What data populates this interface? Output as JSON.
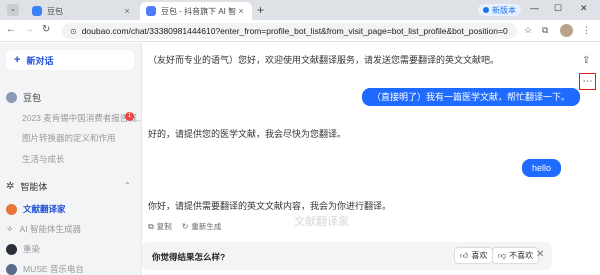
{
  "browser": {
    "tabs": [
      {
        "label": "豆包",
        "close": "×"
      },
      {
        "label": "豆包 - 抖音旗下 AI 智能助手",
        "close": "×"
      }
    ],
    "new_tab": "+",
    "new_version_badge": "新版本",
    "window_controls": [
      "—",
      "☐",
      "✕"
    ],
    "url": "doubao.com/chat/33380981444610?enter_from=profile_bot_list&from_visit_page=bot_list_profile&bot_position=0"
  },
  "sidebar": {
    "new_chat_label": "新对话",
    "section_doubao": "豆包",
    "history": [
      "2023 麦肯锡中国消费者报告概...",
      "图片转换器的定义和作用",
      "生活与成长"
    ],
    "history_badge": "1",
    "section_agents": "智能体",
    "bots": [
      {
        "label": "文献翻译家",
        "active": true
      },
      {
        "label": "AI 智能体生成器",
        "active": false
      },
      {
        "label": "重染",
        "active": false
      },
      {
        "label": "MUSE 音乐电台",
        "active": false
      }
    ]
  },
  "chat": {
    "bot_intro": "（友好而专业的语气）您好，欢迎使用文献翻译服务，请发送您需要翻译的英文文献吧。",
    "user_msg_1": "（直接明了）我有一篇医学文献，帮忙翻译一下。",
    "bot_reply_1": "好的，请提供您的医学文献，我会尽快为您翻译。",
    "user_msg_2": "hello",
    "bot_reply_2": "你好，请提供需要翻译的英文文献内容，我会为你进行翻译。",
    "watermark": "文献翻译家",
    "actions": [
      "复制",
      "重新生成"
    ],
    "feedback": {
      "question": "你觉得结果怎么样?",
      "like": "喜欢",
      "dislike": "不喜欢",
      "close": "✕"
    }
  },
  "icons": {
    "share": "share-icon",
    "more": "more-icon"
  },
  "colors": {
    "accent": "#1f6bff",
    "highlight_box": "#e02020"
  }
}
